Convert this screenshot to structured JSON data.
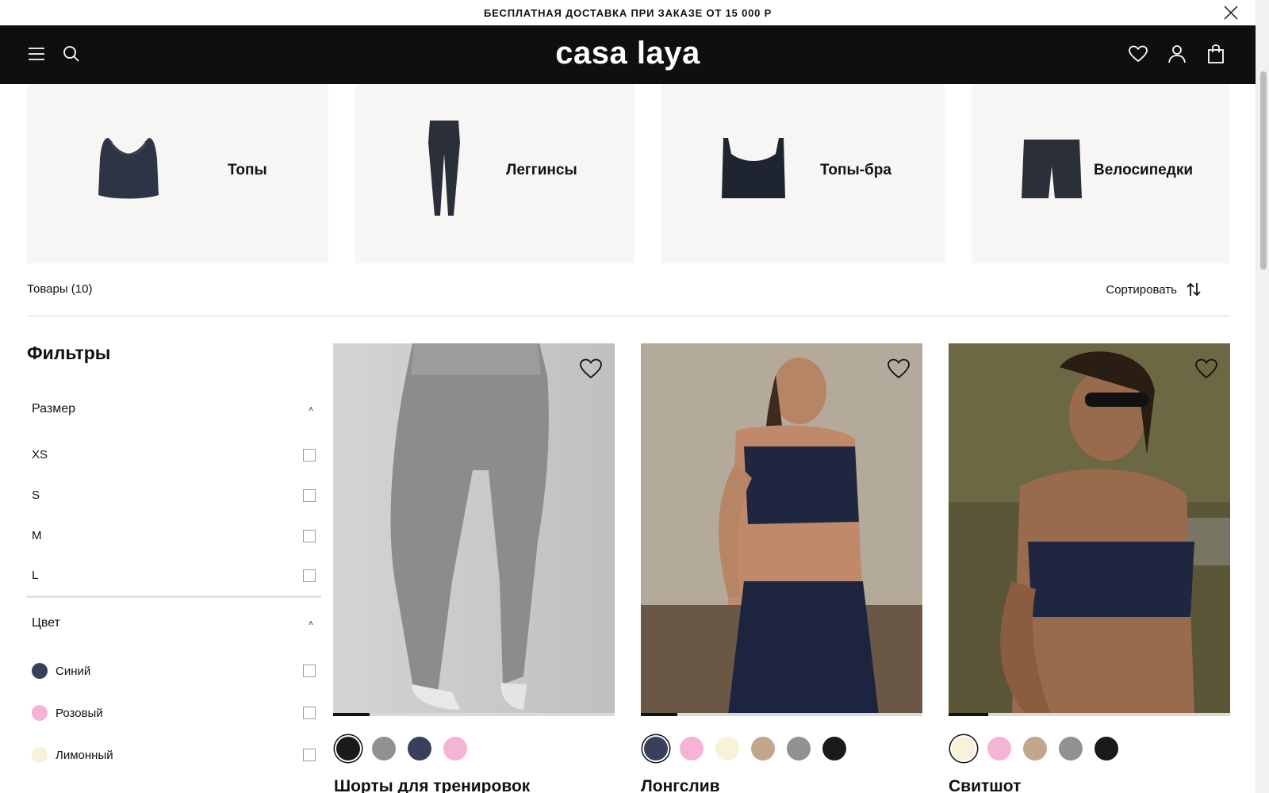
{
  "announcement": {
    "text": "БЕСПЛАТНАЯ ДОСТАВКА ПРИ ЗАКАЗЕ ОТ 15 000 Р",
    "close_icon": "close-icon"
  },
  "header": {
    "logo": "casa laya",
    "icons": [
      "menu-icon",
      "search-icon",
      "heart-icon",
      "user-icon",
      "bag-icon"
    ],
    "background": "#0f0f0f"
  },
  "categories": [
    {
      "label": "Топы",
      "icon": "sports-top-icon"
    },
    {
      "label": "Леггинсы",
      "icon": "leggings-icon"
    },
    {
      "label": "Топы-бра",
      "icon": "bra-top-icon"
    },
    {
      "label": "Велосипедки",
      "icon": "bike-shorts-icon"
    }
  ],
  "toolbar": {
    "count": "Товары (10)",
    "sort_label": "Сортировать"
  },
  "filters": {
    "title": "Фильтры",
    "size": {
      "label": "Размер",
      "options": [
        "XS",
        "S",
        "M",
        "L"
      ]
    },
    "color": {
      "label": "Цвет",
      "options": [
        {
          "label": "Синий",
          "hex": "#3a3f5c"
        },
        {
          "label": "Розовый",
          "hex": "#f5b3d6"
        },
        {
          "label": "Лимонный",
          "hex": "#f7f2d8"
        }
      ]
    }
  },
  "products": [
    {
      "name": "Шорты для тренировок",
      "image_progress": 0.13,
      "colors": [
        "#1a1a1a",
        "#8f9195",
        "#3a3f5c",
        "#f5b3d6"
      ],
      "selected_color": 0
    },
    {
      "name": "Лонгслив",
      "image_progress": 0.13,
      "colors": [
        "#3a3f5c",
        "#f5b3d6",
        "#f7f2d8",
        "#bfa88a",
        "#8f9195",
        "#1a1a1a"
      ],
      "selected_color": 0
    },
    {
      "name": "Свитшот",
      "image_progress": 0.14,
      "colors": [
        "#f7f2d8",
        "#f5b3d6",
        "#bfa88a",
        "#8f9195",
        "#1a1a1a"
      ],
      "selected_color": 0
    }
  ]
}
